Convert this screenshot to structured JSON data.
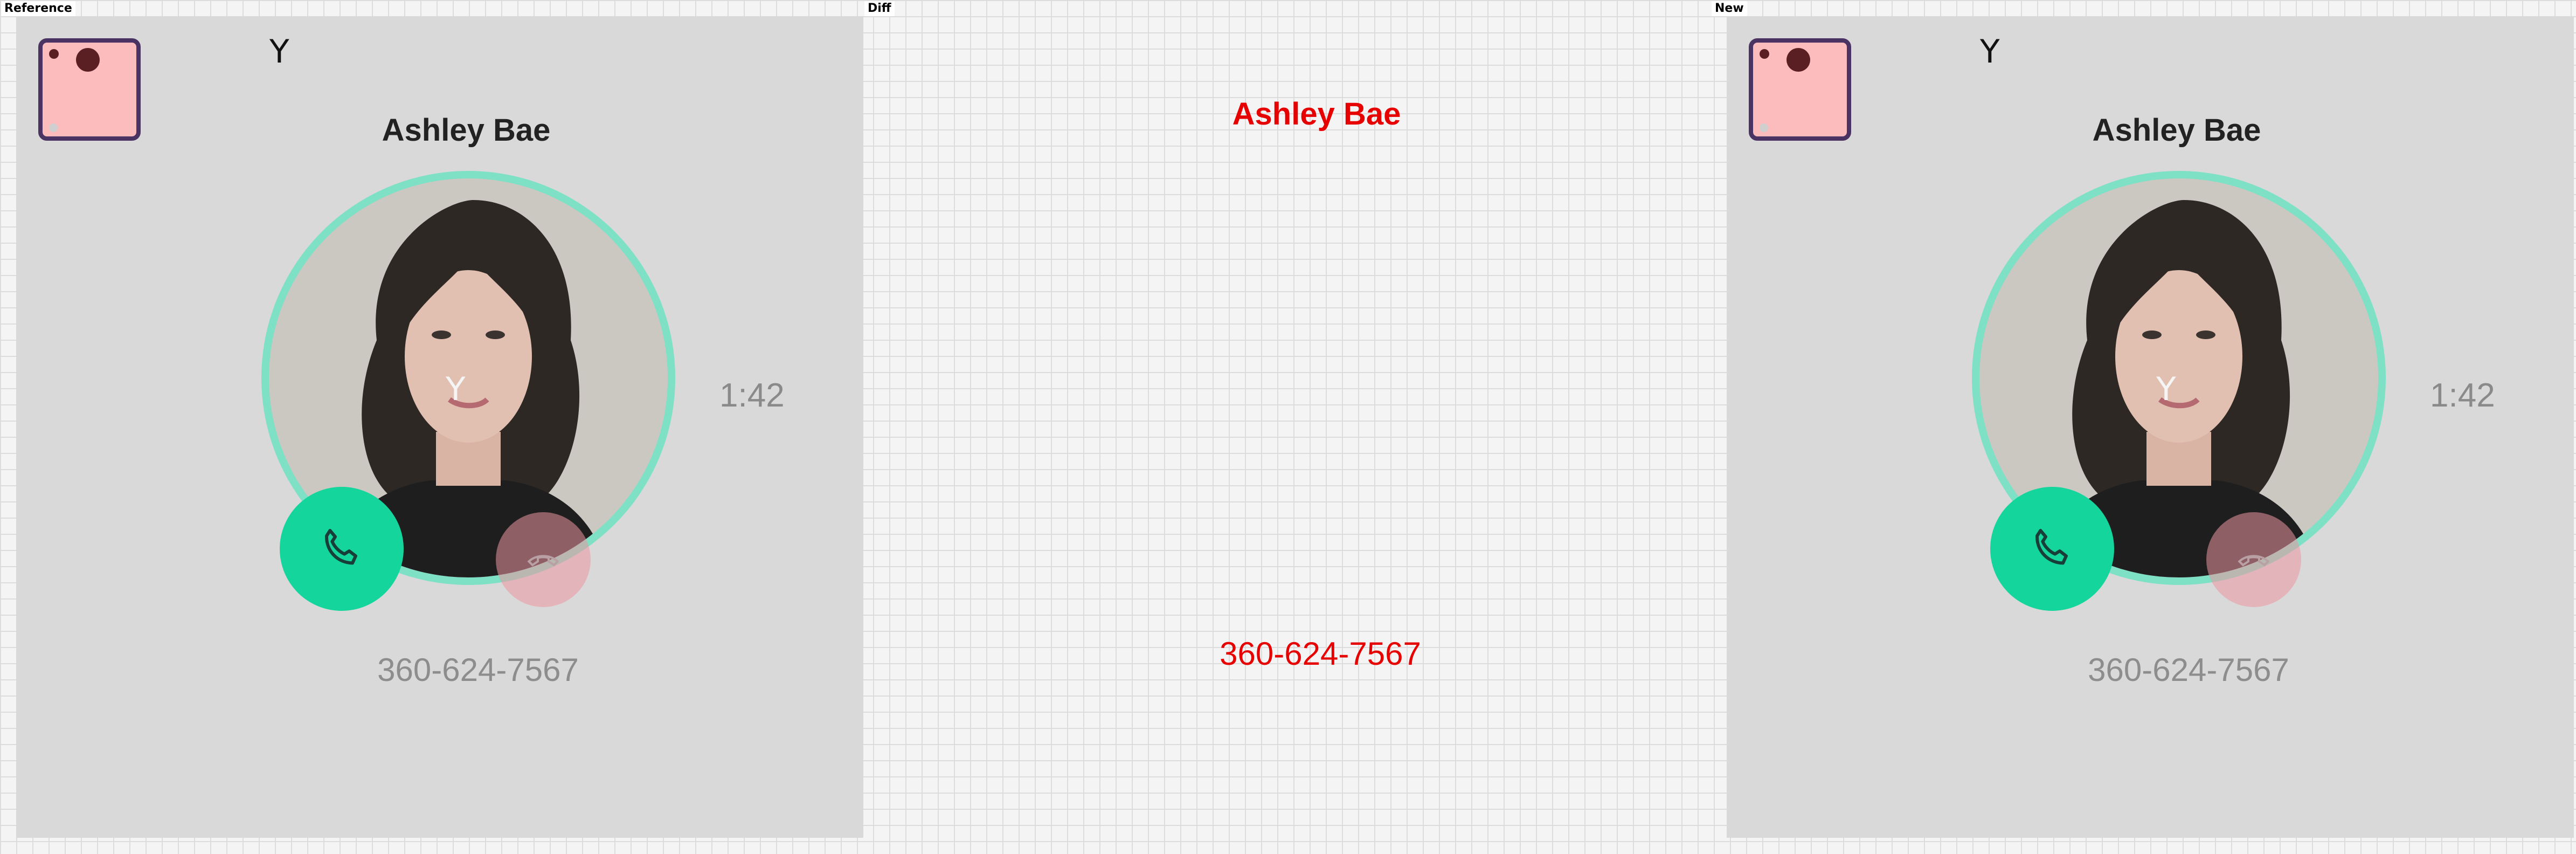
{
  "panels": {
    "reference": {
      "label": "Reference"
    },
    "diff": {
      "label": "Diff"
    },
    "new": {
      "label": "New"
    }
  },
  "call": {
    "marker": "Y",
    "contact_name": "Ashley Bae",
    "face_marker": "Y",
    "timer": "1:42",
    "phone_number": "360-624-7567"
  },
  "icons": {
    "app_icon": "app-icon",
    "accept": "phone-icon",
    "decline": "hangup-icon"
  },
  "colors": {
    "accept_button": "#14d69c",
    "avatar_ring": "#7ee0c4",
    "decline_button": "#eb96a0",
    "diff_highlight": "#e60000",
    "app_icon_border": "#4a3263",
    "app_icon_fill": "#fcbcbe"
  }
}
